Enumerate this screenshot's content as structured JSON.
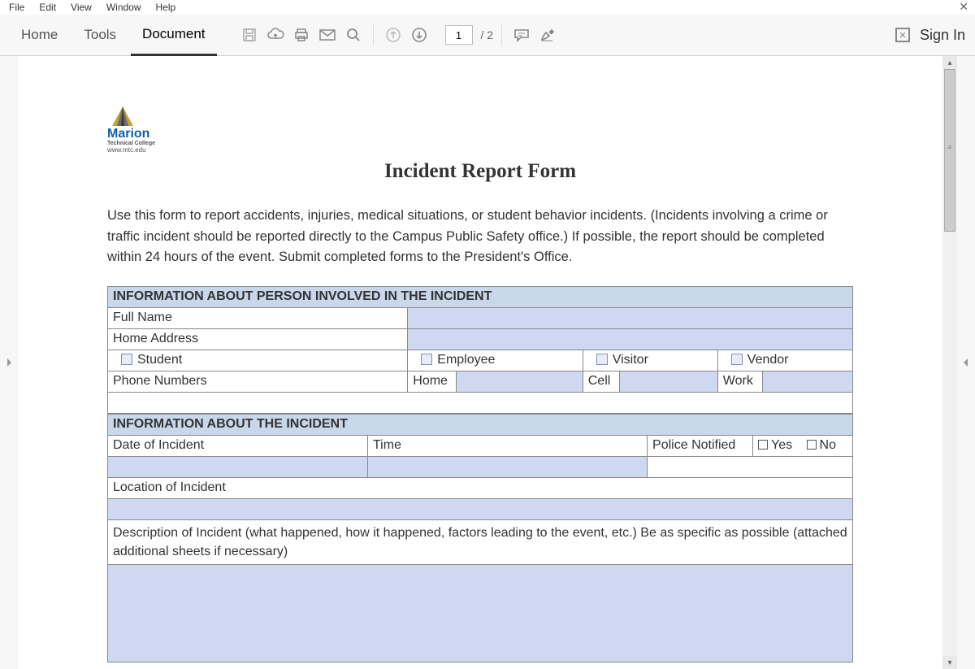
{
  "menubar": [
    "File",
    "Edit",
    "View",
    "Window",
    "Help"
  ],
  "tabs": {
    "home": "Home",
    "tools": "Tools",
    "document": "Document"
  },
  "page": {
    "current": "1",
    "total": "/ 2"
  },
  "signin": "Sign In",
  "logo": {
    "name": "Marion",
    "sub": "Technical College",
    "url": "www.mtc.edu"
  },
  "doc": {
    "title": "Incident Report Form",
    "intro": "Use this form to report accidents, injuries, medical situations, or student behavior incidents. (Incidents involving a crime or traffic incident should be reported directly to the Campus Public Safety office.) If possible, the report should be completed within 24 hours of the event. Submit completed forms to the President's Office.",
    "sec1": "INFORMATION ABOUT PERSON INVOLVED IN THE INCIDENT",
    "fullname": "Full Name",
    "address": "Home Address",
    "student": "Student",
    "employee": "Employee",
    "visitor": "Visitor",
    "vendor": "Vendor",
    "phones": "Phone Numbers",
    "phone_home": "Home",
    "phone_cell": "Cell",
    "phone_work": "Work",
    "sec2": "INFORMATION ABOUT THE INCIDENT",
    "date": "Date of Incident",
    "time": "Time",
    "police": "Police Notified",
    "yes": "Yes",
    "no": "No",
    "location": "Location of Incident",
    "desc": "Description of Incident (what happened, how it happened, factors leading to the event, etc.) Be as specific as possible (attached additional sheets if necessary)"
  }
}
